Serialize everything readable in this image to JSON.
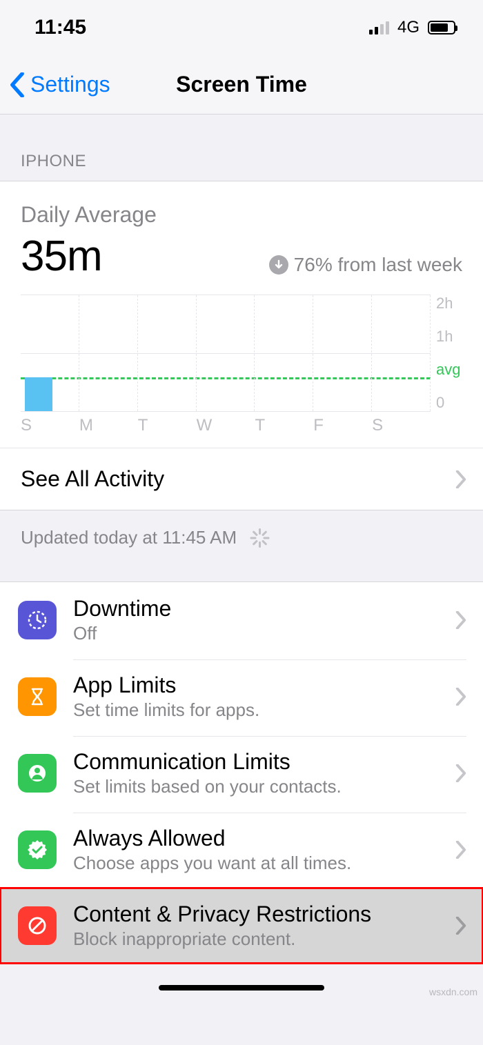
{
  "status": {
    "time": "11:45",
    "network_label": "4G"
  },
  "nav": {
    "back_label": "Settings",
    "title": "Screen Time"
  },
  "section_header": "IPHONE",
  "usage": {
    "daily_average_label": "Daily Average",
    "daily_average_value": "35m",
    "trend_text": "76% from last week",
    "axis": {
      "top": "2h",
      "mid": "1h",
      "avg": "avg",
      "bottom": "0"
    },
    "days": [
      "S",
      "M",
      "T",
      "W",
      "T",
      "F",
      "S"
    ],
    "see_all": "See All Activity",
    "updated": "Updated today at 11:45 AM"
  },
  "rows": [
    {
      "title": "Downtime",
      "subtitle": "Off"
    },
    {
      "title": "App Limits",
      "subtitle": "Set time limits for apps."
    },
    {
      "title": "Communication Limits",
      "subtitle": "Set limits based on your contacts."
    },
    {
      "title": "Always Allowed",
      "subtitle": "Choose apps you want at all times."
    },
    {
      "title": "Content & Privacy Restrictions",
      "subtitle": "Block inappropriate content."
    }
  ],
  "chart_data": {
    "type": "bar",
    "title": "Daily Average 35m",
    "categories": [
      "S",
      "M",
      "T",
      "W",
      "T",
      "F",
      "S"
    ],
    "values": [
      0.58,
      0,
      0,
      0,
      0,
      0,
      0
    ],
    "ylabel": "hours",
    "ylim": [
      0,
      2
    ],
    "avg_line": 0.58,
    "annotations": [
      "avg"
    ]
  },
  "watermark": "wsxdn.com"
}
